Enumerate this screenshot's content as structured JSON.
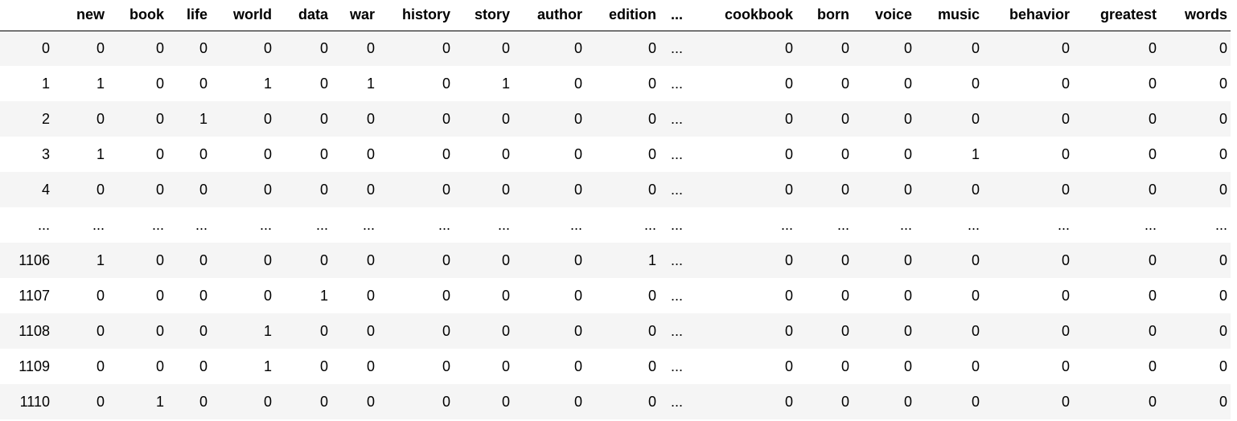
{
  "table": {
    "columns": [
      "new",
      "book",
      "life",
      "world",
      "data",
      "war",
      "history",
      "story",
      "author",
      "edition",
      "...",
      "cookbook",
      "born",
      "voice",
      "music",
      "behavior",
      "greatest",
      "words"
    ],
    "rows": [
      {
        "index": "0",
        "cells": [
          "0",
          "0",
          "0",
          "0",
          "0",
          "0",
          "0",
          "0",
          "0",
          "0",
          "...",
          "0",
          "0",
          "0",
          "0",
          "0",
          "0",
          "0"
        ]
      },
      {
        "index": "1",
        "cells": [
          "1",
          "0",
          "0",
          "1",
          "0",
          "1",
          "0",
          "1",
          "0",
          "0",
          "...",
          "0",
          "0",
          "0",
          "0",
          "0",
          "0",
          "0"
        ]
      },
      {
        "index": "2",
        "cells": [
          "0",
          "0",
          "1",
          "0",
          "0",
          "0",
          "0",
          "0",
          "0",
          "0",
          "...",
          "0",
          "0",
          "0",
          "0",
          "0",
          "0",
          "0"
        ]
      },
      {
        "index": "3",
        "cells": [
          "1",
          "0",
          "0",
          "0",
          "0",
          "0",
          "0",
          "0",
          "0",
          "0",
          "...",
          "0",
          "0",
          "0",
          "1",
          "0",
          "0",
          "0"
        ]
      },
      {
        "index": "4",
        "cells": [
          "0",
          "0",
          "0",
          "0",
          "0",
          "0",
          "0",
          "0",
          "0",
          "0",
          "...",
          "0",
          "0",
          "0",
          "0",
          "0",
          "0",
          "0"
        ]
      },
      {
        "index": "...",
        "cells": [
          "...",
          "...",
          "...",
          "...",
          "...",
          "...",
          "...",
          "...",
          "...",
          "...",
          "...",
          "...",
          "...",
          "...",
          "...",
          "...",
          "...",
          "..."
        ]
      },
      {
        "index": "1106",
        "cells": [
          "1",
          "0",
          "0",
          "0",
          "0",
          "0",
          "0",
          "0",
          "0",
          "1",
          "...",
          "0",
          "0",
          "0",
          "0",
          "0",
          "0",
          "0"
        ]
      },
      {
        "index": "1107",
        "cells": [
          "0",
          "0",
          "0",
          "0",
          "1",
          "0",
          "0",
          "0",
          "0",
          "0",
          "...",
          "0",
          "0",
          "0",
          "0",
          "0",
          "0",
          "0"
        ]
      },
      {
        "index": "1108",
        "cells": [
          "0",
          "0",
          "0",
          "1",
          "0",
          "0",
          "0",
          "0",
          "0",
          "0",
          "...",
          "0",
          "0",
          "0",
          "0",
          "0",
          "0",
          "0"
        ]
      },
      {
        "index": "1109",
        "cells": [
          "0",
          "0",
          "0",
          "1",
          "0",
          "0",
          "0",
          "0",
          "0",
          "0",
          "...",
          "0",
          "0",
          "0",
          "0",
          "0",
          "0",
          "0"
        ]
      },
      {
        "index": "1110",
        "cells": [
          "0",
          "1",
          "0",
          "0",
          "0",
          "0",
          "0",
          "0",
          "0",
          "0",
          "...",
          "0",
          "0",
          "0",
          "0",
          "0",
          "0",
          "0"
        ]
      }
    ]
  }
}
